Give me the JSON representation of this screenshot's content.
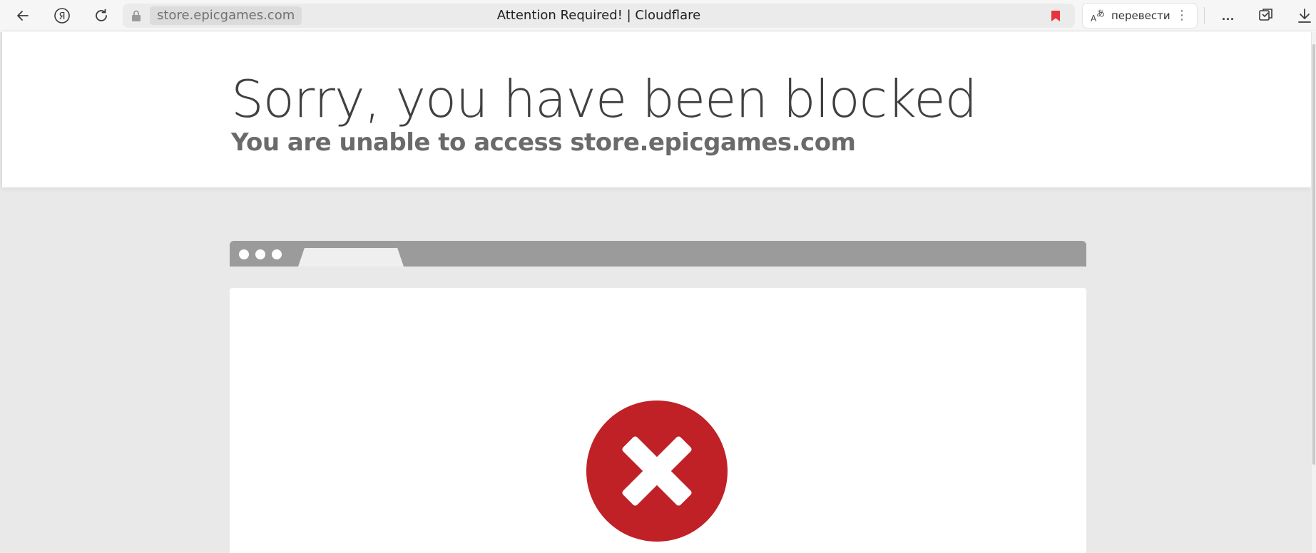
{
  "browser": {
    "url": "store.epicgames.com",
    "tab_title": "Attention Required! | Cloudflare",
    "translate_label": "перевести",
    "more_label": "...",
    "yandex_letter": "Я",
    "kebab": "⋮"
  },
  "page": {
    "headline": "Sorry, you have been blocked",
    "subline": "You are unable to access store.epicgames.com"
  },
  "colors": {
    "block_red": "#bf2126",
    "bookmark_red": "#e8333a"
  },
  "icons": [
    "back-arrow-icon",
    "yandex-icon",
    "reload-icon",
    "lock-icon",
    "bookmark-icon",
    "translate-icon",
    "kebab-icon",
    "collections-icon",
    "download-icon",
    "block-x-icon"
  ]
}
